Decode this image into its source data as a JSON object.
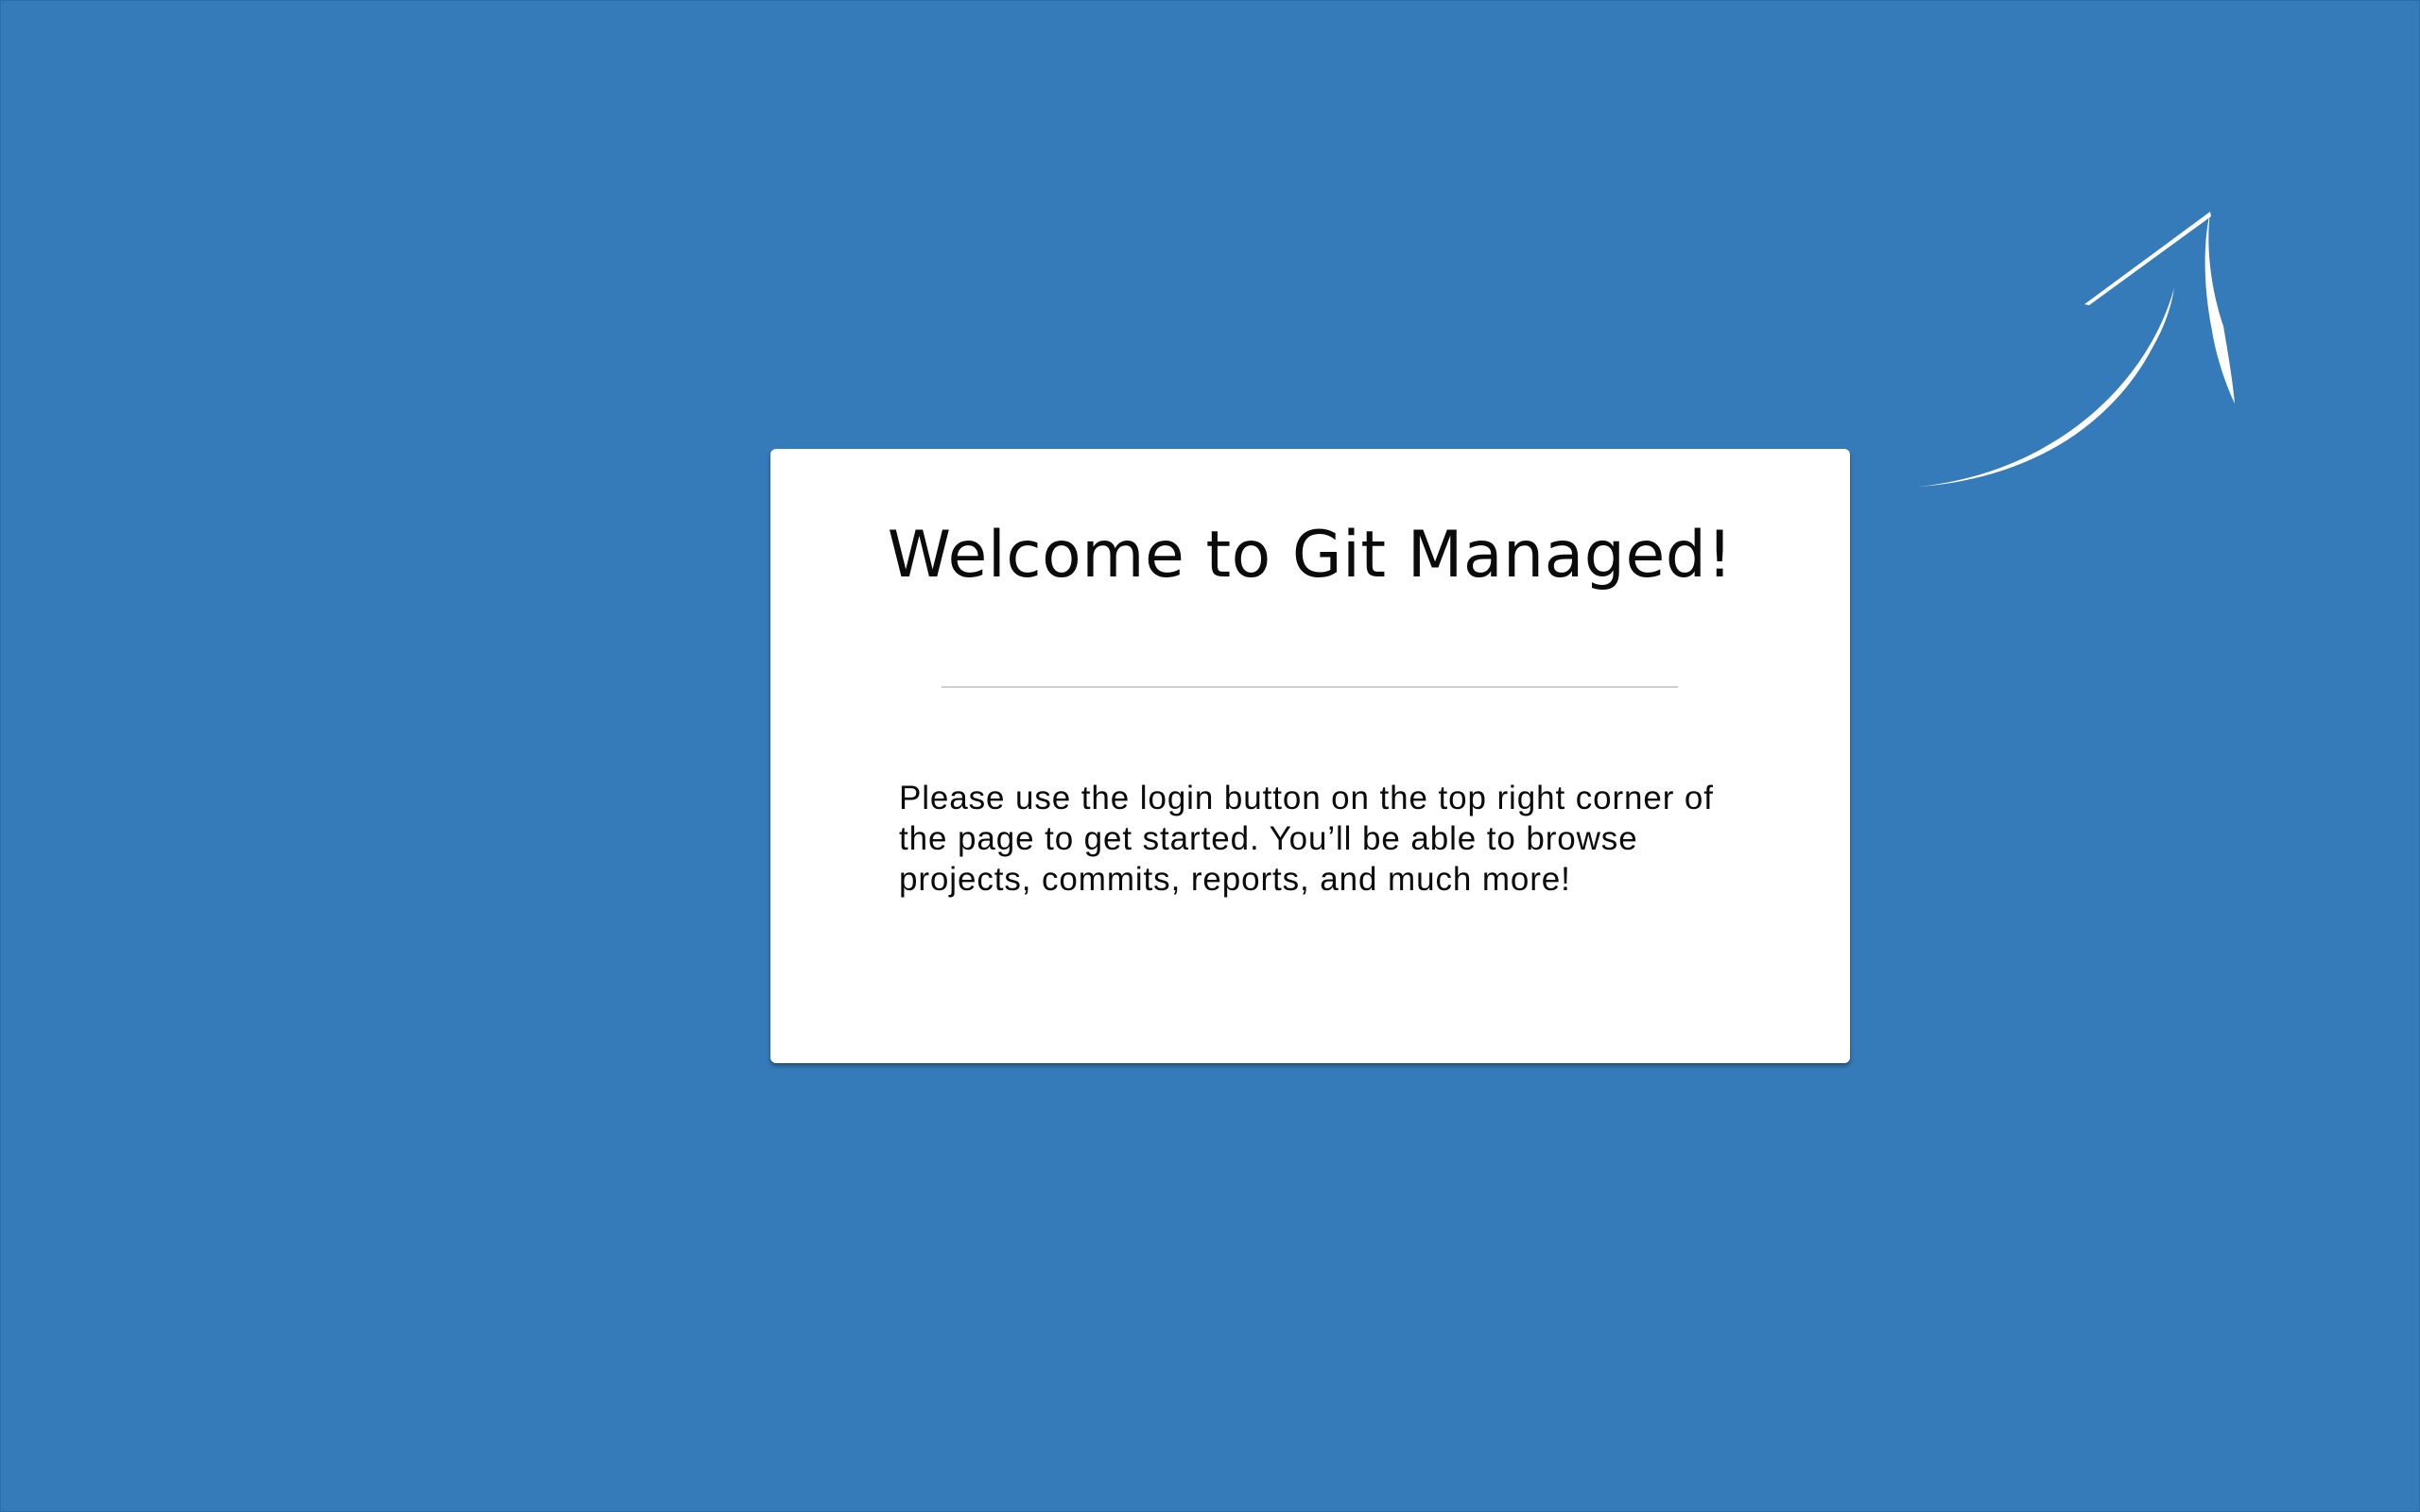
{
  "page": {
    "background_color": "#357ab9"
  },
  "welcome_card": {
    "title": "Welcome to Git Managed!",
    "message": "Please use the login button on the top right corner of the page to get started. You’ll be able to browse projects, commits, reports, and much more!",
    "background_color": "#ffffff"
  },
  "pointer": {
    "icon": "curved-arrow-up-right-icon",
    "color": "#ffffff"
  }
}
